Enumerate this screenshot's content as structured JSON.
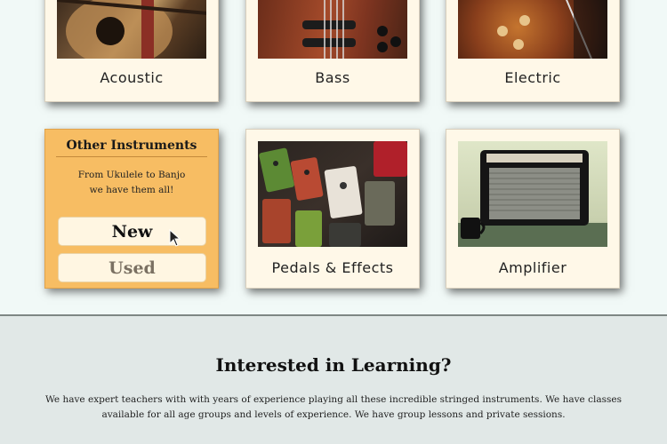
{
  "products": {
    "acoustic": {
      "label": "Acoustic"
    },
    "bass": {
      "label": "Bass"
    },
    "electric": {
      "label": "Electric"
    },
    "pedals": {
      "label": "Pedals & Effects"
    },
    "amplifier": {
      "label": "Amplifier"
    }
  },
  "other_instruments": {
    "title": "Other Instruments",
    "line1": "From Ukulele to Banjo",
    "line2": "we have them all!",
    "new_label": "New",
    "used_label": "Used"
  },
  "learning": {
    "title": "Interested in Learning?",
    "body": "We have expert teachers with with years of experience playing all these incredible stringed instruments. We have classes available for all age groups and levels of experience.  We have group lessons and private sessions."
  },
  "colors": {
    "accent": "#f7bd63",
    "card": "#fff8e8",
    "page": "#f1f9f7",
    "section": "#e1e8e7"
  }
}
